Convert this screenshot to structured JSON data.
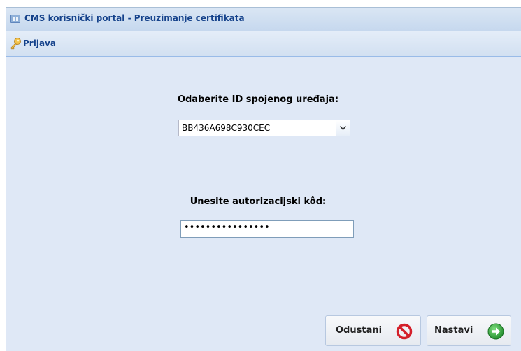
{
  "window": {
    "title": "CMS korisnički portal - Preuzimanje certifikata",
    "title_icon": "window-icon"
  },
  "panel": {
    "title": "Prijava",
    "icon": "key-icon"
  },
  "form": {
    "device_label": "Odaberite ID spojenog uređaja:",
    "device_selected": "BB436A698C930CEC",
    "auth_label": "Unesite autorizacijski kôd:",
    "auth_value": "••••••••••••••••"
  },
  "buttons": {
    "cancel_label": "Odustani",
    "cancel_icon": "cancel-icon",
    "next_label": "Nastavi",
    "next_icon": "arrow-right-icon"
  },
  "colors": {
    "title_text": "#15428b",
    "panel_bg": "#dfe8f6",
    "cancel_icon": "#d4202a",
    "next_icon": "#2e9e3a"
  }
}
